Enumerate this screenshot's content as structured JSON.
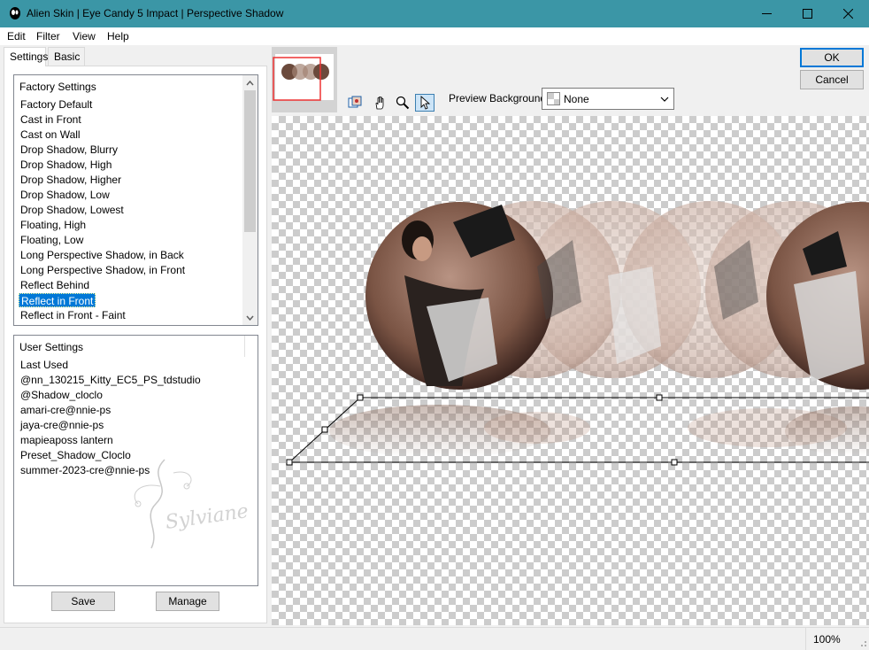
{
  "window": {
    "title": "Alien Skin | Eye Candy 5 Impact | Perspective Shadow",
    "icon": "alien-skin-app-icon"
  },
  "menu": {
    "items": [
      {
        "label": "Edit"
      },
      {
        "label": "Filter"
      },
      {
        "label": "View"
      },
      {
        "label": "Help"
      }
    ]
  },
  "tabs": [
    {
      "label": "Settings",
      "active": true
    },
    {
      "label": "Basic",
      "active": false
    }
  ],
  "factory_settings": {
    "header": "Factory Settings",
    "items": [
      {
        "label": "Factory Default"
      },
      {
        "label": "Cast in Front"
      },
      {
        "label": "Cast on Wall"
      },
      {
        "label": "Drop Shadow, Blurry"
      },
      {
        "label": "Drop Shadow, High"
      },
      {
        "label": "Drop Shadow, Higher"
      },
      {
        "label": "Drop Shadow, Low"
      },
      {
        "label": "Drop Shadow, Lowest"
      },
      {
        "label": "Floating, High"
      },
      {
        "label": "Floating, Low"
      },
      {
        "label": "Long Perspective Shadow, in Back"
      },
      {
        "label": "Long Perspective Shadow, in Front"
      },
      {
        "label": "Reflect Behind"
      },
      {
        "label": "Reflect in Front"
      },
      {
        "label": "Reflect in Front - Faint"
      }
    ],
    "selected": "Reflect in Front"
  },
  "user_settings": {
    "header": "User Settings",
    "items": [
      {
        "label": "Last Used"
      },
      {
        "label": "@nn_130215_Kitty_EC5_PS_tdstudio"
      },
      {
        "label": "@Shadow_cloclo"
      },
      {
        "label": "amari-cre@nnie-ps"
      },
      {
        "label": "jaya-cre@nnie-ps"
      },
      {
        "label": "mapieaposs lantern"
      },
      {
        "label": "Preset_Shadow_Cloclo"
      },
      {
        "label": "summer-2023-cre@nnie-ps"
      }
    ],
    "watermark": "Sylviane"
  },
  "buttons": {
    "save": "Save",
    "manage": "Manage",
    "ok": "OK",
    "cancel": "Cancel"
  },
  "preview": {
    "background_label": "Preview Background:",
    "background_value": "None",
    "tools": [
      "preview-toggle-icon",
      "hand-pan-icon",
      "zoom-magnifier-icon",
      "arrow-select-icon"
    ],
    "active_tool": "arrow-select-icon"
  },
  "status": {
    "zoom": "100%"
  }
}
